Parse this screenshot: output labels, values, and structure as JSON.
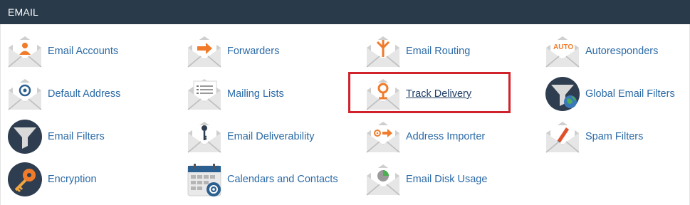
{
  "section_title": "EMAIL",
  "items": [
    {
      "label": "Email Accounts",
      "icon": "person-envelope-icon"
    },
    {
      "label": "Forwarders",
      "icon": "arrow-envelope-icon"
    },
    {
      "label": "Email Routing",
      "icon": "routing-envelope-icon"
    },
    {
      "label": "Autoresponders",
      "icon": "auto-envelope-icon",
      "badge": "AUTO"
    },
    {
      "label": "Default Address",
      "icon": "at-envelope-icon"
    },
    {
      "label": "Mailing Lists",
      "icon": "list-envelope-icon"
    },
    {
      "label": "Track Delivery",
      "icon": "pin-envelope-icon",
      "highlighted": true
    },
    {
      "label": "Global Email Filters",
      "icon": "globe-filter-icon"
    },
    {
      "label": "Email Filters",
      "icon": "filter-icon"
    },
    {
      "label": "Email Deliverability",
      "icon": "key-envelope-icon"
    },
    {
      "label": "Address Importer",
      "icon": "import-envelope-icon"
    },
    {
      "label": "Spam Filters",
      "icon": "pencil-envelope-icon"
    },
    {
      "label": "Encryption",
      "icon": "key-circle-icon"
    },
    {
      "label": "Calendars and Contacts",
      "icon": "calendar-at-icon"
    },
    {
      "label": "Email Disk Usage",
      "icon": "pie-envelope-icon"
    }
  ],
  "colors": {
    "header_bg": "#293a4a",
    "link": "#2b6aa6",
    "orange": "#f07b2a",
    "highlight_border": "#d0222a",
    "navy": "#2e3d4f"
  }
}
